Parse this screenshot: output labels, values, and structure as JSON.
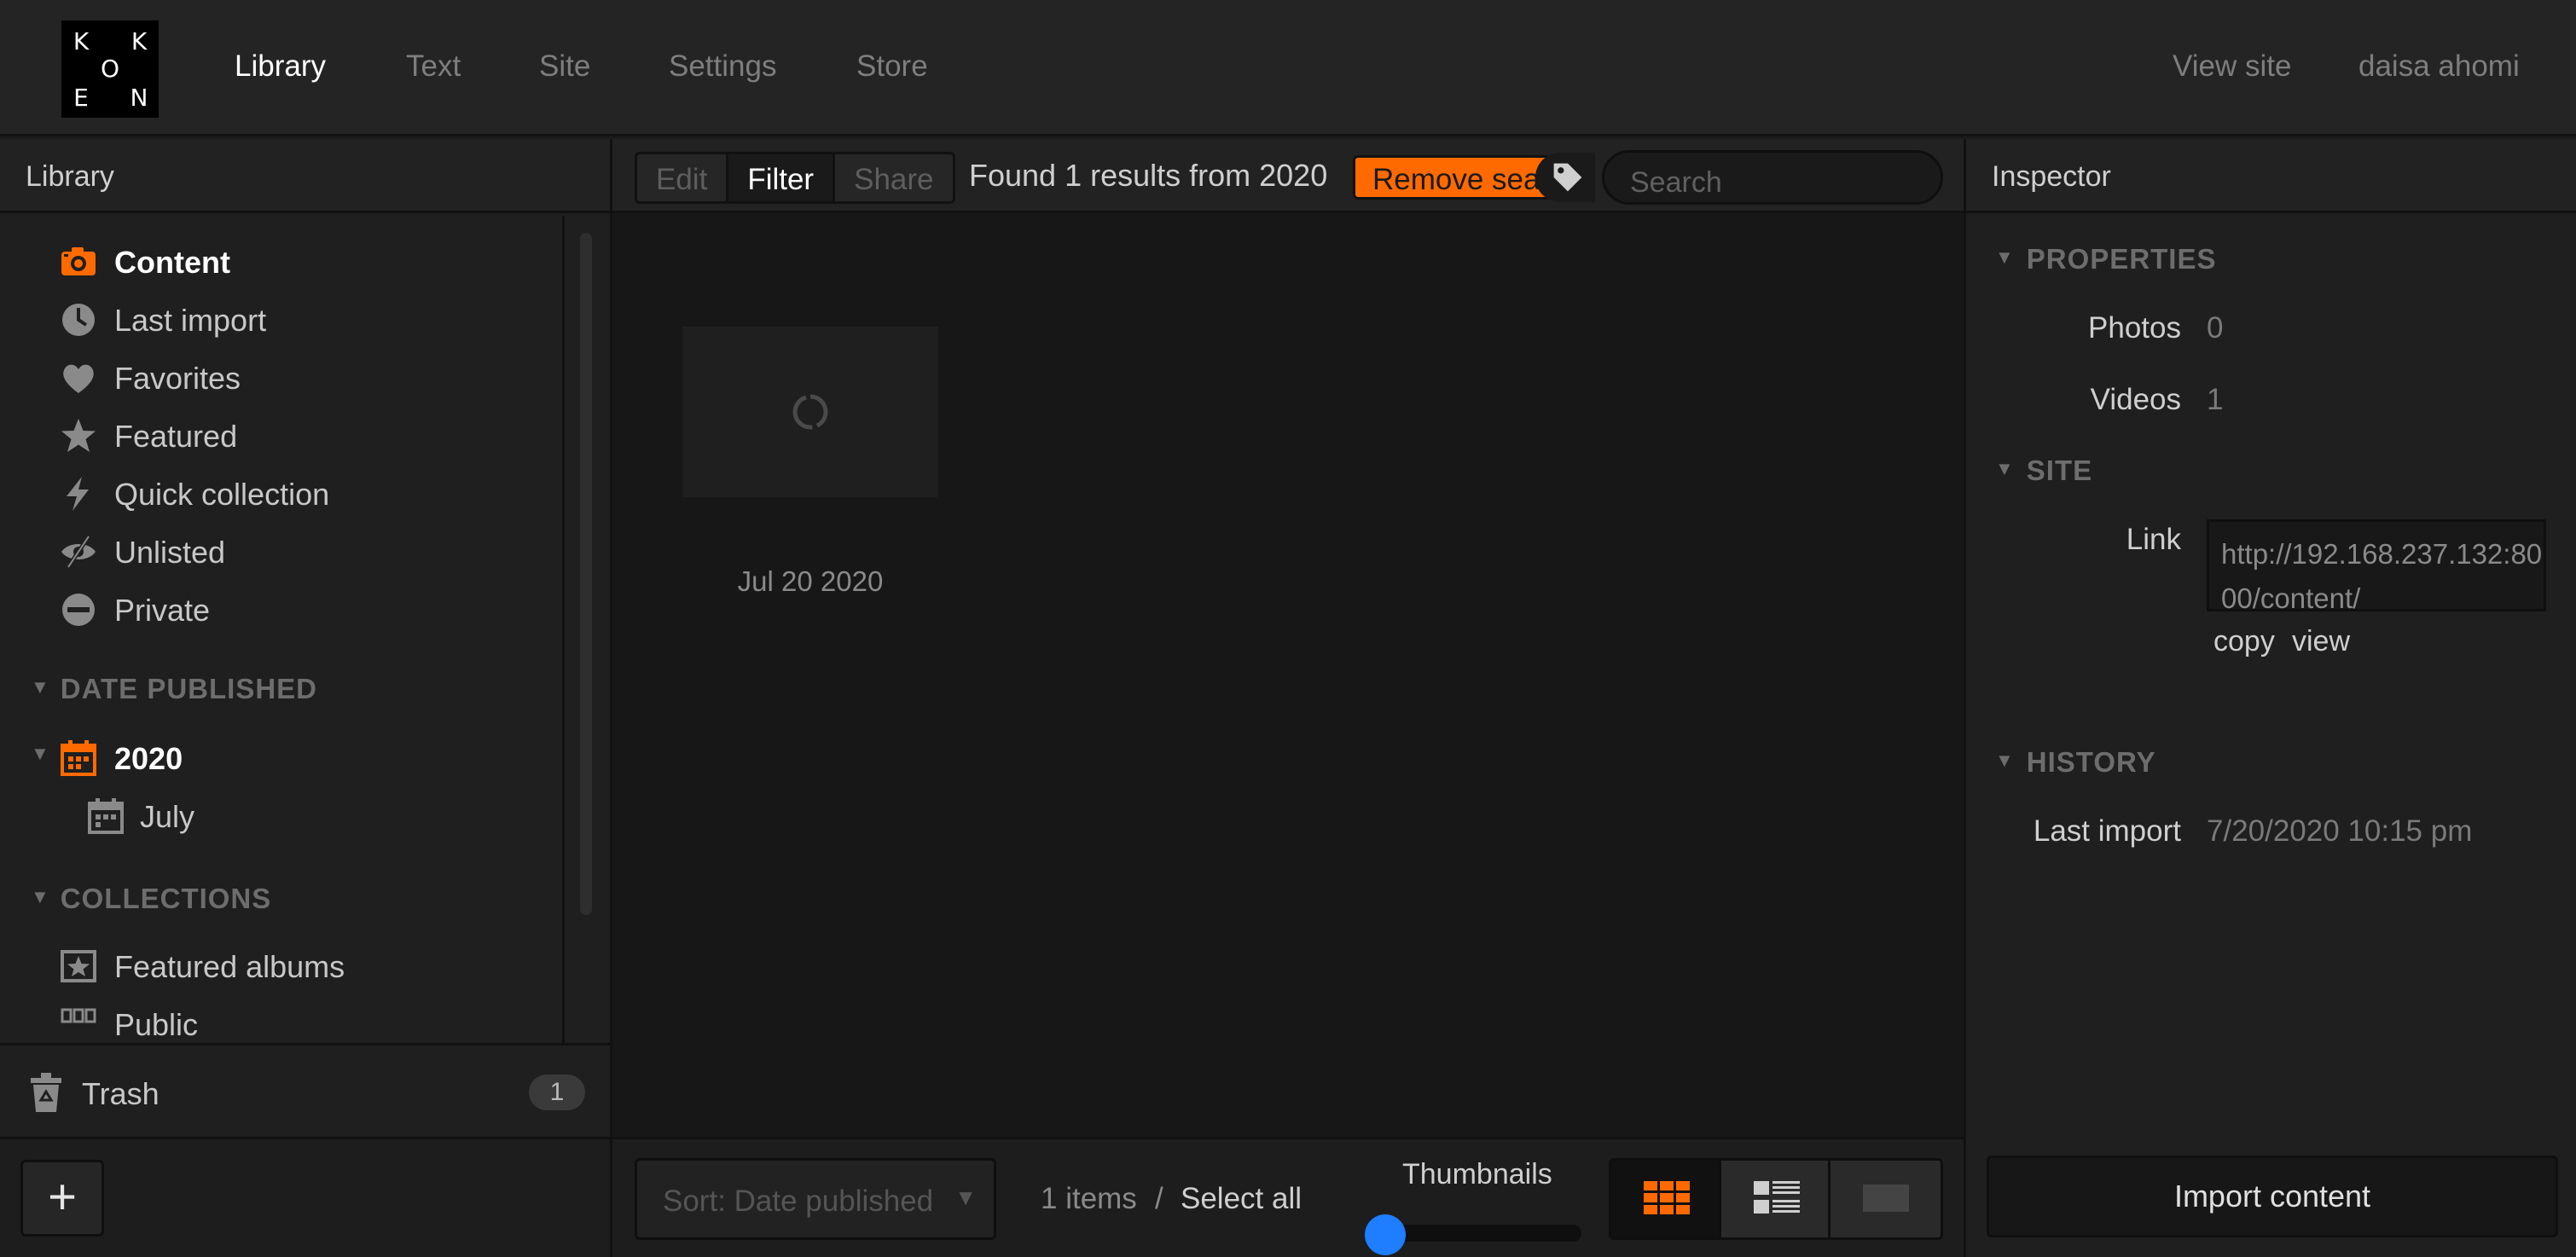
{
  "logo": {
    "letters": [
      "K",
      "K",
      "O",
      "E",
      "N"
    ]
  },
  "topnav": {
    "items": [
      "Library",
      "Text",
      "Site",
      "Settings",
      "Store"
    ],
    "view_site": "View site",
    "user": "daisa ahomi"
  },
  "sidebar": {
    "title": "Library",
    "items": [
      {
        "label": "Content",
        "icon": "camera-icon"
      },
      {
        "label": "Last import",
        "icon": "clock-icon"
      },
      {
        "label": "Favorites",
        "icon": "heart-icon"
      },
      {
        "label": "Featured",
        "icon": "star-icon"
      },
      {
        "label": "Quick collection",
        "icon": "lightning-icon"
      },
      {
        "label": "Unlisted",
        "icon": "hidden-eye-icon"
      },
      {
        "label": "Private",
        "icon": "no-entry-icon"
      }
    ],
    "date_section": "DATE PUBLISHED",
    "year": "2020",
    "month": "July",
    "collections_section": "COLLECTIONS",
    "collections": [
      "Featured albums",
      "Public"
    ],
    "trash_label": "Trash",
    "trash_count": "1",
    "add_label": "+"
  },
  "toolbar": {
    "edit": "Edit",
    "filter": "Filter",
    "share": "Share",
    "found": "Found 1 results from 2020",
    "remove": "Remove search",
    "search_placeholder": "Search"
  },
  "grid": {
    "items": [
      {
        "date": "Jul 20 2020"
      }
    ]
  },
  "footer": {
    "sort": "Sort: Date published",
    "items_count": "1 items",
    "separator": "/",
    "select_all": "Select all",
    "thumbnails": "Thumbnails"
  },
  "inspector": {
    "title": "Inspector",
    "properties": "PROPERTIES",
    "photos_label": "Photos",
    "photos_value": "0",
    "videos_label": "Videos",
    "videos_value": "1",
    "site": "SITE",
    "link_label": "Link",
    "link_value": "http://192.168.237.132:8000/content/",
    "copy": "copy",
    "view": "view",
    "history": "HISTORY",
    "last_import_label": "Last import",
    "last_import_value": "7/20/2020 10:15 pm",
    "import_button": "Import content"
  },
  "colors": {
    "accent": "#ff6a00",
    "slider": "#1f7dff",
    "background": "#1b1b1b"
  }
}
